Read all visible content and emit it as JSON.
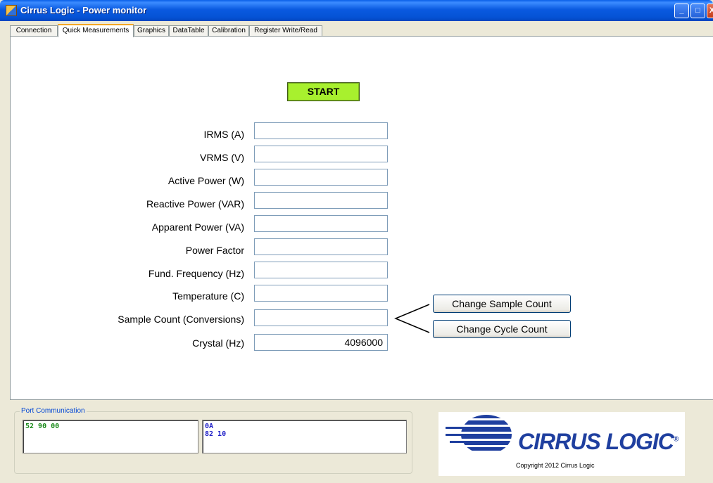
{
  "window": {
    "title": "Cirrus Logic - Power monitor",
    "minimize_label": "_",
    "maximize_label": "□",
    "close_label": "X"
  },
  "tabs": [
    {
      "label": "Connection"
    },
    {
      "label": "Quick Measurements",
      "active": true
    },
    {
      "label": "Graphics"
    },
    {
      "label": "DataTable"
    },
    {
      "label": "Calibration"
    },
    {
      "label": "Register Write/Read"
    }
  ],
  "quick_measurements": {
    "start_label": "START",
    "fields": [
      {
        "label": "IRMS (A)",
        "value": ""
      },
      {
        "label": "VRMS (V)",
        "value": ""
      },
      {
        "label": "Active Power (W)",
        "value": ""
      },
      {
        "label": "Reactive Power (VAR)",
        "value": ""
      },
      {
        "label": "Apparent Power (VA)",
        "value": ""
      },
      {
        "label": "Power Factor",
        "value": ""
      },
      {
        "label": "Fund. Frequency (Hz)",
        "value": ""
      },
      {
        "label": "Temperature (C)",
        "value": ""
      },
      {
        "label": "Sample Count (Conversions)",
        "value": ""
      },
      {
        "label": "Crystal (Hz)",
        "value": "4096000"
      }
    ],
    "change_sample_count_label": "Change Sample Count",
    "change_cycle_count_label": "Change Cycle Count"
  },
  "port_communication": {
    "title": "Port Communication",
    "sent_text": "52 90 00",
    "received_text": "0A\n82 10"
  },
  "logo": {
    "text": "CIRRUS LOGIC",
    "registered_mark": "®",
    "copyright": "Copyright 2012 Cirrus Logic"
  },
  "colors": {
    "start_button": "#A8F02E",
    "sent_text": "#1A8A1A",
    "received_text": "#2020C8",
    "logo_blue": "#1F3F9F"
  }
}
